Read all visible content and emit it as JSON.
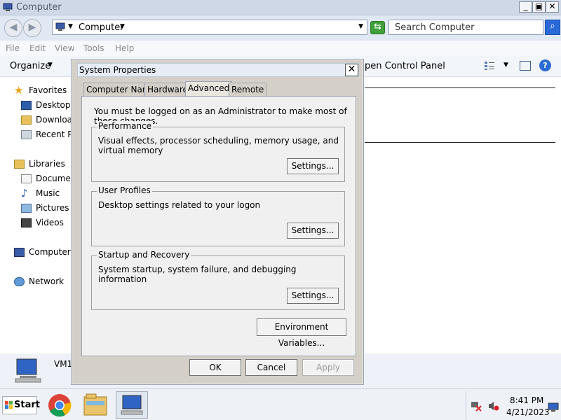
{
  "window": {
    "title": "Computer",
    "controls": {
      "minimize": "_",
      "maximize": "▣",
      "close": "✕"
    }
  },
  "address": {
    "path": "Computer",
    "search_placeholder": "Search Computer"
  },
  "menu": [
    "File",
    "Edit",
    "View",
    "Tools",
    "Help"
  ],
  "toolbar": {
    "organize": "Organize",
    "open_control_panel": "pen Control Panel",
    "help": "?"
  },
  "nav": {
    "favorites": "Favorites",
    "desktop": "Desktop",
    "downloads": "Downloa",
    "recent": "Recent Pl",
    "libraries": "Libraries",
    "documents": "Documer",
    "music": "Music",
    "pictures": "Pictures",
    "videos": "Videos",
    "computer": "Computer",
    "network": "Network"
  },
  "details": {
    "name": "VM1"
  },
  "dialog": {
    "title": "System Properties",
    "close": "✕",
    "tabs": [
      "Computer Name",
      "Hardware",
      "Advanced",
      "Remote"
    ],
    "selected_tab": "Advanced",
    "admin_message": "You must be logged on as an Administrator to make most of these changes.",
    "performance": {
      "title": "Performance",
      "desc": "Visual effects, processor scheduling, memory usage, and virtual memory",
      "button": "Settings..."
    },
    "user_profiles": {
      "title": "User Profiles",
      "desc": "Desktop settings related to your logon",
      "button": "Settings..."
    },
    "startup_recovery": {
      "title": "Startup and Recovery",
      "desc": "System startup, system failure, and debugging information",
      "button": "Settings..."
    },
    "env_button": "Environment Variables...",
    "ok": "OK",
    "cancel": "Cancel",
    "apply": "Apply"
  },
  "taskbar": {
    "start": "Start",
    "time": "8:41 PM",
    "date": "4/21/2023"
  },
  "colors": {
    "titlebar": "#cfd8e6",
    "dialog_bg": "#d4d0c8",
    "panel_bg": "#f0f0f0",
    "search_button": "#2a6ad8",
    "refresh": "#3f9f3a"
  }
}
